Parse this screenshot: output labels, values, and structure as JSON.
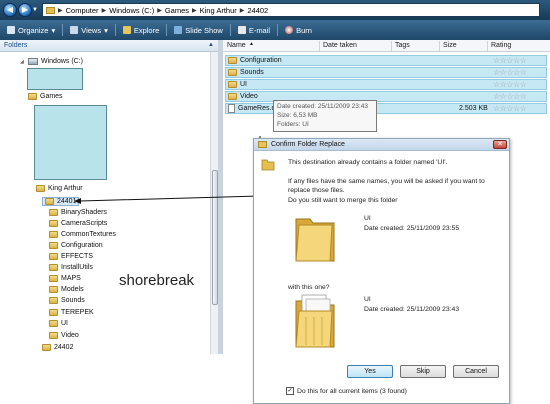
{
  "address": {
    "crumbs": [
      "Computer",
      "Windows (C:)",
      "Games",
      "King Arthur",
      "24402"
    ]
  },
  "toolbar": {
    "organize": "Organize",
    "views": "Views",
    "explore": "Explore",
    "slideshow": "Slide Show",
    "email": "E-mail",
    "burn": "Burn"
  },
  "folders_pane": {
    "header": "Folders",
    "items": [
      {
        "label": "Windows (C:)",
        "icon": "drive-icon"
      },
      {
        "label": "Games",
        "icon": "folder-icon"
      },
      {
        "label": "King Arthur",
        "icon": "folder-icon"
      },
      {
        "label": "24401",
        "icon": "folder-icon"
      },
      {
        "label": "BinaryShaders",
        "icon": "folder-icon"
      },
      {
        "label": "CameraScripts",
        "icon": "folder-icon"
      },
      {
        "label": "CommonTextures",
        "icon": "folder-icon"
      },
      {
        "label": "Configuration",
        "icon": "folder-icon"
      },
      {
        "label": "EFFECTS",
        "icon": "folder-icon"
      },
      {
        "label": "InstallUtils",
        "icon": "folder-icon"
      },
      {
        "label": "MAPS",
        "icon": "folder-icon"
      },
      {
        "label": "Models",
        "icon": "folder-icon"
      },
      {
        "label": "Sounds",
        "icon": "folder-icon"
      },
      {
        "label": "TEREPEK",
        "icon": "folder-icon"
      },
      {
        "label": "UI",
        "icon": "folder-icon"
      },
      {
        "label": "Video",
        "icon": "folder-icon"
      },
      {
        "label": "24402",
        "icon": "folder-icon"
      }
    ]
  },
  "watermark": "shorebreak",
  "file_list": {
    "columns": [
      "Name",
      "Date taken",
      "Tags",
      "Size",
      "Rating"
    ],
    "rows": [
      {
        "name": "Configuration",
        "size": ""
      },
      {
        "name": "Sounds",
        "size": ""
      },
      {
        "name": "UI",
        "size": ""
      },
      {
        "name": "Video",
        "size": ""
      },
      {
        "name": "GameRes.d",
        "size": "2.503 KB"
      }
    ]
  },
  "tooltip": {
    "line1": "Date created: 25/11/2009 23:43",
    "line2": "Size: 6,53 MB",
    "line3": "Folders: UI"
  },
  "dialog": {
    "title": "Confirm Folder Replace",
    "msg1": "This destination already contains a folder named 'UI'.",
    "msg2": "If any files have the same names, you will be asked if you want to replace those files.",
    "question": "Do you still want to merge this folder",
    "first_name": "UI",
    "first_date": "Date created: 25/11/2009 23:55",
    "with": "with this one?",
    "second_name": "UI",
    "second_date": "Date created: 25/11/2009 23:43",
    "yes": "Yes",
    "skip": "Skip",
    "cancel": "Cancel",
    "checkbox_label": "Do this for all current items (3 found)",
    "checkbox_checked": true
  }
}
